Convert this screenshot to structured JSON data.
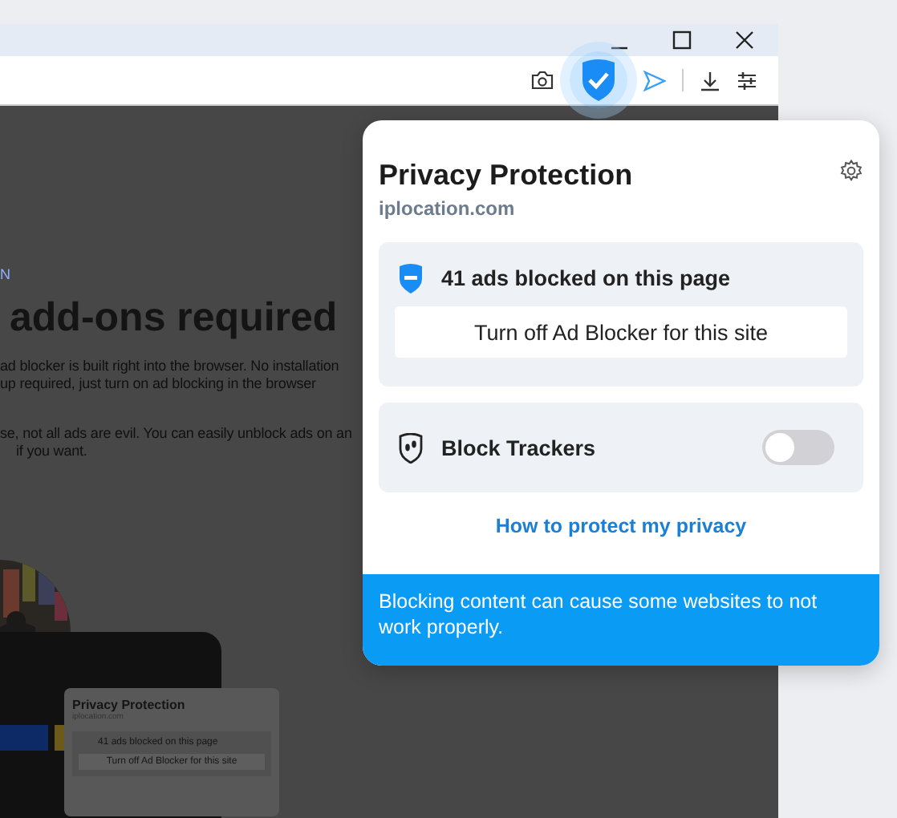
{
  "page": {
    "eyebrow": "N",
    "heading": "add-ons required",
    "paragraph_lines": [
      "ad blocker is built right into the browser. No installation",
      "up required, just turn on ad blocking in the browser"
    ],
    "second_lines": [
      "se, not all ads are evil. You can easily unblock ads on an",
      "if you want."
    ],
    "illustration": {
      "title": "Privacy Protection",
      "site": "iplocation.com",
      "blocked_text": "41 ads blocked on this page",
      "button": "Turn off Ad Blocker for this site"
    }
  },
  "popup": {
    "title": "Privacy Protection",
    "site": "iplocation.com",
    "ad_blocker": {
      "text": "41 ads blocked on this page",
      "button": "Turn off Ad Blocker for this site"
    },
    "trackers": {
      "label": "Block Trackers",
      "on": false
    },
    "link": "How to protect my privacy",
    "warning": "Blocking content can cause some websites to not work properly."
  }
}
